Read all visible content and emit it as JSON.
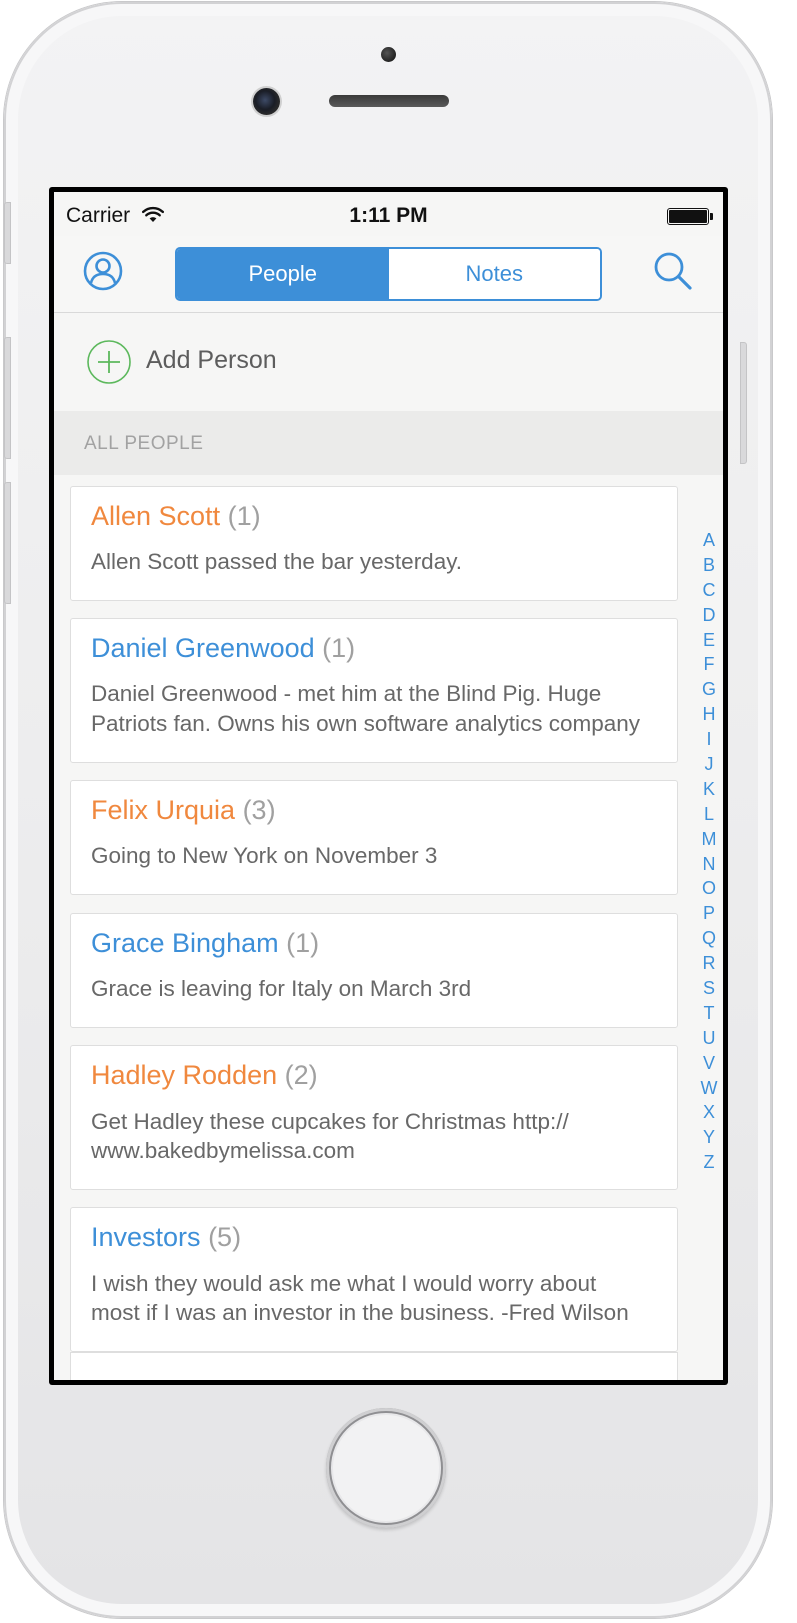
{
  "status_bar": {
    "carrier": "Carrier",
    "time": "1:11 PM"
  },
  "nav": {
    "segments": [
      {
        "label": "People",
        "active": true
      },
      {
        "label": "Notes",
        "active": false
      }
    ],
    "icons": [
      "profile-icon",
      "search-icon"
    ]
  },
  "add_person": {
    "label": "Add Person",
    "icon": "plus-circle-icon"
  },
  "section": {
    "title": "ALL PEOPLE"
  },
  "people": [
    {
      "name": "Allen Scott",
      "count": "(1)",
      "note": "Allen Scott passed the bar yesterday.",
      "color": "#f0883e"
    },
    {
      "name": "Daniel Greenwood",
      "count": "(1)",
      "note_line1": "Daniel Greenwood - met him at the Blind Pig. Huge",
      "note_line2": "Patriots fan. Owns his own software analytics company",
      "color": "#3d8fd8"
    },
    {
      "name": "Felix Urquia",
      "count": "(3)",
      "note": "Going to New York on November 3",
      "color": "#f0883e"
    },
    {
      "name": "Grace Bingham",
      "count": "(1)",
      "note": "Grace is leaving for Italy on March 3rd",
      "color": "#3d8fd8"
    },
    {
      "name": "Hadley Rodden",
      "count": "(2)",
      "note_line1": "Get Hadley these cupcakes for Christmas http://",
      "note_line2": "www.bakedbymelissa.com",
      "color": "#f0883e"
    },
    {
      "name": "Investors",
      "count": "(5)",
      "note_line1": "I wish they would ask me what I would worry about",
      "note_line2": "most if I was an investor in the business. -Fred Wilson",
      "color": "#3d8fd8"
    }
  ],
  "index_letters": [
    "A",
    "B",
    "C",
    "D",
    "E",
    "F",
    "G",
    "H",
    "I",
    "J",
    "K",
    "L",
    "M",
    "N",
    "O",
    "P",
    "Q",
    "R",
    "S",
    "T",
    "U",
    "V",
    "W",
    "X",
    "Y",
    "Z"
  ],
  "colors": {
    "accent_blue": "#3d8fd8",
    "accent_orange": "#f0883e",
    "add_green": "#5cb85c"
  }
}
